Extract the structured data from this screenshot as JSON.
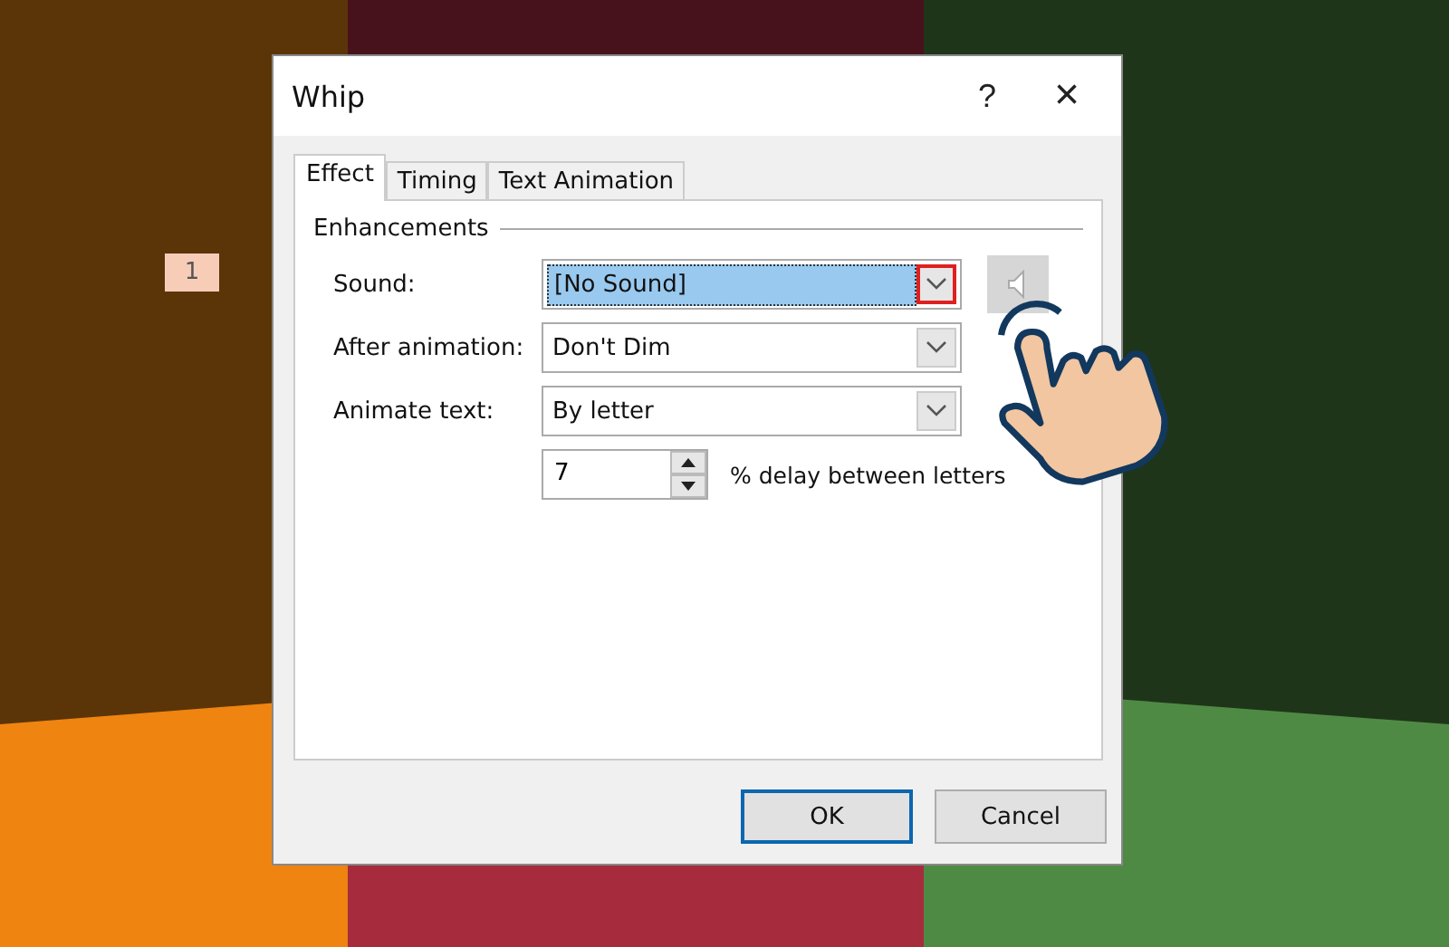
{
  "slide": {
    "badge": "1"
  },
  "dialog": {
    "title": "Whip",
    "help": "?",
    "close": "×",
    "tabs": [
      {
        "label": "Effect",
        "selected": true
      },
      {
        "label": "Timing",
        "selected": false
      },
      {
        "label": "Text Animation",
        "selected": false
      }
    ],
    "group": "Enhancements",
    "fields": [
      {
        "label": "Sound:",
        "value": "[No Sound]",
        "selected": true,
        "highlighted": true,
        "speaker": true
      },
      {
        "label": "After animation:",
        "value": "Don't Dim",
        "selected": false,
        "highlighted": false,
        "speaker": false
      },
      {
        "label": "Animate text:",
        "value": "By letter",
        "selected": false,
        "highlighted": false,
        "speaker": false
      }
    ],
    "delay": {
      "value": "7",
      "label": "% delay between letters"
    },
    "buttons": [
      {
        "label": "OK",
        "default": true
      },
      {
        "label": "Cancel",
        "default": false
      }
    ]
  }
}
